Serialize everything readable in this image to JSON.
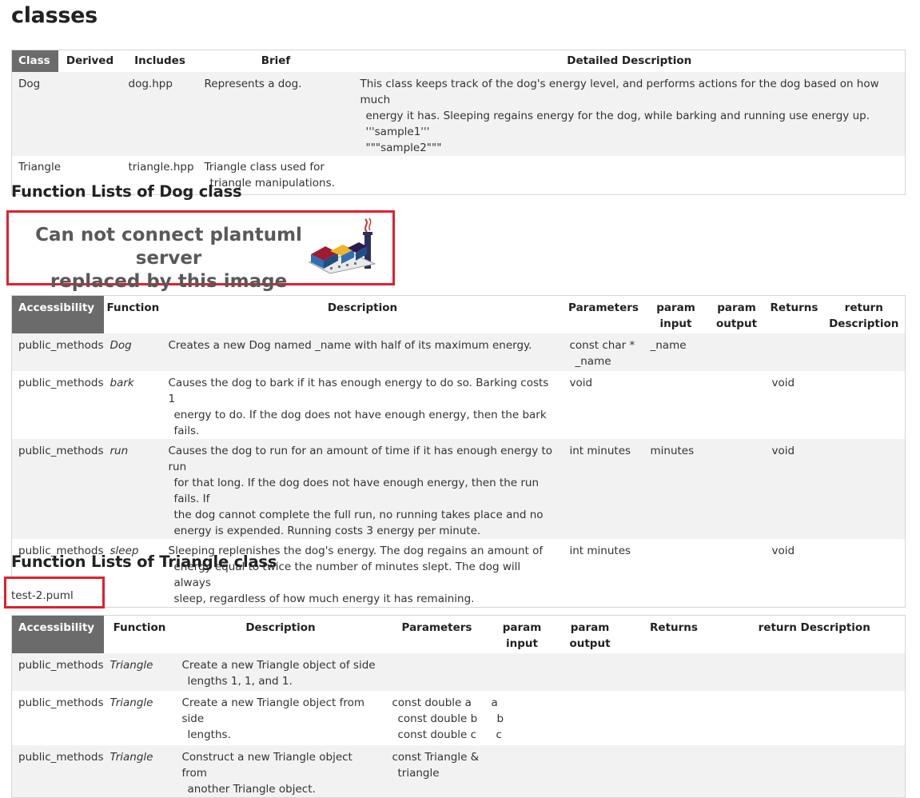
{
  "page_title": "classes",
  "classes_table": {
    "headers": [
      "Class",
      "Derived",
      "Includes",
      "Brief",
      "Detailed Description"
    ],
    "rows": [
      {
        "class": "Dog",
        "derived": "",
        "includes": "dog.hpp",
        "brief": "Represents a dog.",
        "detailed_line1": "This class keeps track of the dog's energy level, and performs actions for the dog based on how much",
        "detailed_line2": "energy it has. Sleeping regains energy for the dog, while barking and running use energy up. '''sample1'''",
        "detailed_line3": "\"\"\"sample2\"\"\""
      },
      {
        "class": "Triangle",
        "derived": "",
        "includes": "triangle.hpp",
        "brief_line1": "Triangle class used for",
        "brief_line2": "triangle manipulations.",
        "detailed": ""
      }
    ]
  },
  "dog_section": {
    "heading": "Function Lists of Dog class",
    "image_text_line1": "Can not connect plantuml server",
    "image_text_line2": "replaced by this image",
    "headers": {
      "accessibility": "Accessibility",
      "function": "Function",
      "description": "Description",
      "parameters": "Parameters",
      "param_input_1": "param",
      "param_input_2": "input",
      "param_output_1": "param",
      "param_output_2": "output",
      "returns": "Returns",
      "return_desc_1": "return",
      "return_desc_2": "Description"
    },
    "rows": [
      {
        "access": "public_methods",
        "function": "Dog",
        "desc": [
          "Creates a new Dog named _name with half of its maximum energy."
        ],
        "params": [
          "const char *",
          "_name"
        ],
        "input": [
          "_name"
        ],
        "output": [],
        "returns": "",
        "ret_desc": ""
      },
      {
        "access": "public_methods",
        "function": "bark",
        "desc": [
          "Causes the dog to bark if it has enough energy to do so. Barking costs 1",
          "energy to do. If the dog does not have enough energy, then the bark fails."
        ],
        "params": [
          "void"
        ],
        "input": [],
        "output": [],
        "returns": "void",
        "ret_desc": ""
      },
      {
        "access": "public_methods",
        "function": "run",
        "desc": [
          "Causes the dog to run for an amount of time if it has enough energy to run",
          "for that long. If the dog does not have enough energy, then the run fails. If",
          "the dog cannot complete the full run, no running takes place and no",
          "energy is expended. Running costs 3 energy per minute."
        ],
        "params": [
          "int minutes"
        ],
        "input": [
          "minutes"
        ],
        "output": [],
        "returns": "void",
        "ret_desc": ""
      },
      {
        "access": "public_methods",
        "function": "sleep",
        "desc": [
          "Sleeping replenishes the dog's energy. The dog regains an amount of",
          "energy equal to twice the number of minutes slept. The dog will always",
          "sleep, regardless of how much energy it has remaining."
        ],
        "params": [
          "int minutes"
        ],
        "input": [],
        "output": [],
        "returns": "void",
        "ret_desc": ""
      }
    ]
  },
  "triangle_section": {
    "heading": "Function Lists of Triangle class",
    "image_alt": "test-2.puml",
    "headers": {
      "accessibility": "Accessibility",
      "function": "Function",
      "description": "Description",
      "parameters": "Parameters",
      "param_input_1": "param",
      "param_input_2": "input",
      "param_output_1": "param",
      "param_output_2": "output",
      "returns": "Returns",
      "return_desc": "return Description"
    },
    "rows": [
      {
        "access": "public_methods",
        "function": "Triangle",
        "desc": [
          "Create a new Triangle object of side",
          "lengths 1, 1, and 1."
        ],
        "params": [],
        "input": []
      },
      {
        "access": "public_methods",
        "function": "Triangle",
        "desc": [
          "Create a new Triangle object from side",
          "lengths."
        ],
        "params": [
          "const double a",
          "const double b",
          "const double c"
        ],
        "input": [
          "a",
          "b",
          "c"
        ]
      },
      {
        "access": "public_methods",
        "function": "Triangle",
        "desc": [
          "Construct a new Triangle object from",
          "another Triangle object."
        ],
        "params": [
          "const Triangle &",
          "triangle"
        ],
        "input": []
      }
    ]
  }
}
